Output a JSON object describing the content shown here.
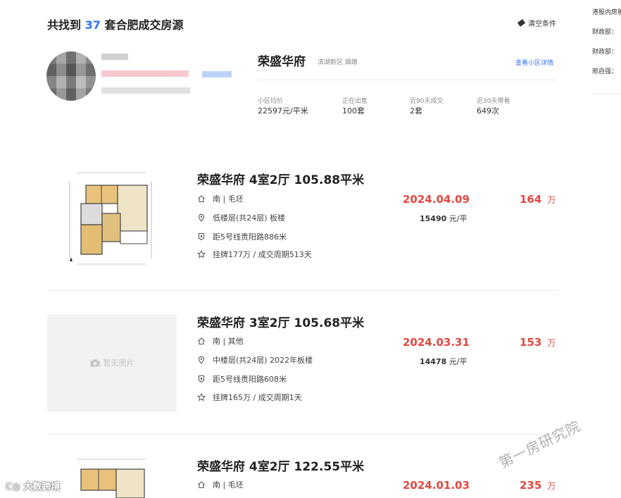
{
  "header": {
    "prefix": "共找到",
    "count": "37",
    "suffix": "套合肥成交房源",
    "clear_label": "清空条件"
  },
  "sidebar_right": {
    "items": [
      {
        "text": "港股内房股"
      },
      {
        "text": "财政部："
      },
      {
        "text": "财政部："
      },
      {
        "text": "邢自强："
      }
    ]
  },
  "community": {
    "name": "荣盛华府",
    "area": "滨湖新区 烟墩",
    "detail_link": "查看小区详情",
    "stats": [
      {
        "label": "小区均价",
        "value": "22597元/平米"
      },
      {
        "label": "正在出售",
        "value": "100套"
      },
      {
        "label": "近90天成交",
        "value": "2套"
      },
      {
        "label": "近30天带看",
        "value": "649次"
      }
    ]
  },
  "listings": [
    {
      "title": "荣盛华府 4室2厅 105.88平米",
      "orientation": "南 | 毛坯",
      "floor": "低楼层(共24层) 板楼",
      "subway": "距5号线贵阳路886米",
      "history": "挂牌177万 / 成交周期513天",
      "deal_date": "2024.04.09",
      "total_price": "164",
      "price_unit": "万",
      "unit_price": "15490",
      "unit_price_suffix": "元/平",
      "image": "floorplan"
    },
    {
      "title": "荣盛华府 3室2厅 105.68平米",
      "orientation": "南 | 其他",
      "floor": "中楼层(共24层) 2022年板楼",
      "subway": "距5号线贵阳路608米",
      "history": "挂牌165万 / 成交周期1天",
      "deal_date": "2024.03.31",
      "total_price": "153",
      "price_unit": "万",
      "unit_price": "14478",
      "unit_price_suffix": "元/平",
      "image": "none",
      "no_image_label": "暂无图片"
    },
    {
      "title": "荣盛华府 4室2厅 122.55平米",
      "orientation": "南 | 毛坯",
      "deal_date": "2024.01.03",
      "total_price": "235",
      "price_unit": "万",
      "image": "floorplan"
    }
  ],
  "watermark": "第一房研究院",
  "logo_text": "大数跨境",
  "colors": {
    "accent": "#3072f6",
    "price": "#e2483f"
  }
}
